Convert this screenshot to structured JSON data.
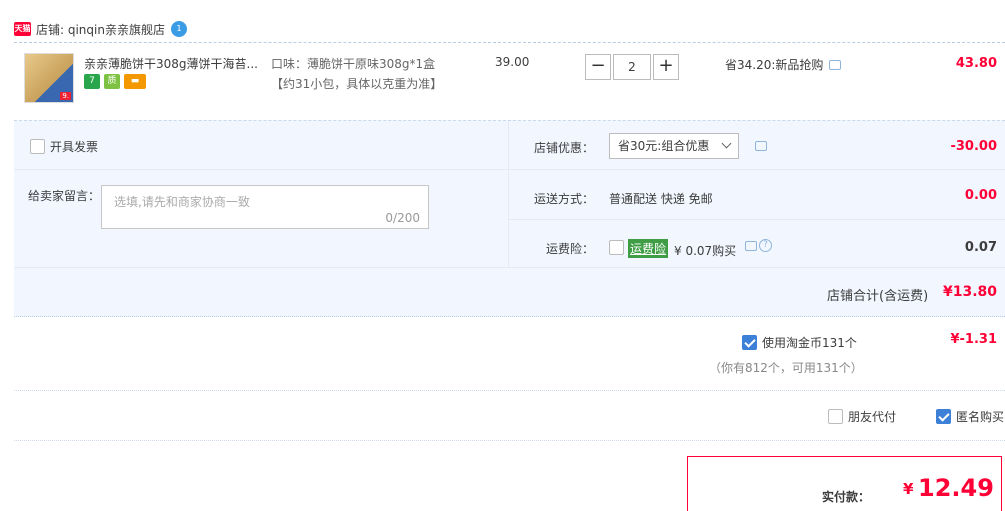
{
  "shop": {
    "badge": "天猫",
    "name": "店铺: qinqin亲亲旗舰店",
    "wangwang": "1"
  },
  "item": {
    "title": "亲亲薄脆饼干308g薄饼干海苔...",
    "thumb_tag": "9.",
    "services": [
      "7",
      "质",
      "▬"
    ],
    "sku_flavor": "口味：薄脆饼干原味308g*1盒",
    "sku_note": "【约31小包，具体以克重为准】",
    "price": "39.00",
    "qty_minus": "−",
    "qty": "2",
    "qty_plus": "+",
    "promo": "省34.20:新品抢购",
    "subtotal": "43.80"
  },
  "options": {
    "invoice_label": "开具发票",
    "message_label": "给卖家留言：",
    "message_placeholder": "选填,请先和商家协商一致",
    "message_count": "0/200",
    "shop_discount_label": "店铺优惠：",
    "shop_discount_select": "省30元:组合优惠",
    "shop_discount_value": "-30.00",
    "shipping_label": "运送方式：",
    "shipping_value": "普通配送 快递 免邮",
    "shipping_fee": "0.00",
    "insurance_label": "运费险：",
    "insurance_badge": "运费险",
    "insurance_price": "¥ 0.07购买",
    "insurance_value": "0.07",
    "help": "?",
    "shop_total_label": "店铺合计(含运费)",
    "shop_total_value": "¥13.80"
  },
  "coins": {
    "label": "使用淘金币131个",
    "checked": true,
    "value": "¥-1.31",
    "note": "（你有812个，可用131个）"
  },
  "extras": {
    "friend_pay_label": "朋友代付",
    "friend_pay_checked": false,
    "anonymous_label": "匿名购买",
    "anonymous_checked": true
  },
  "payment": {
    "label": "实付款：",
    "symbol": "¥",
    "amount": "12.49"
  },
  "colors": {
    "accent_red": "#ff0036",
    "panel_bg": "#f2f7ff",
    "checkbox_blue": "#3d80d7",
    "insurance_green": "#3f9d45"
  }
}
